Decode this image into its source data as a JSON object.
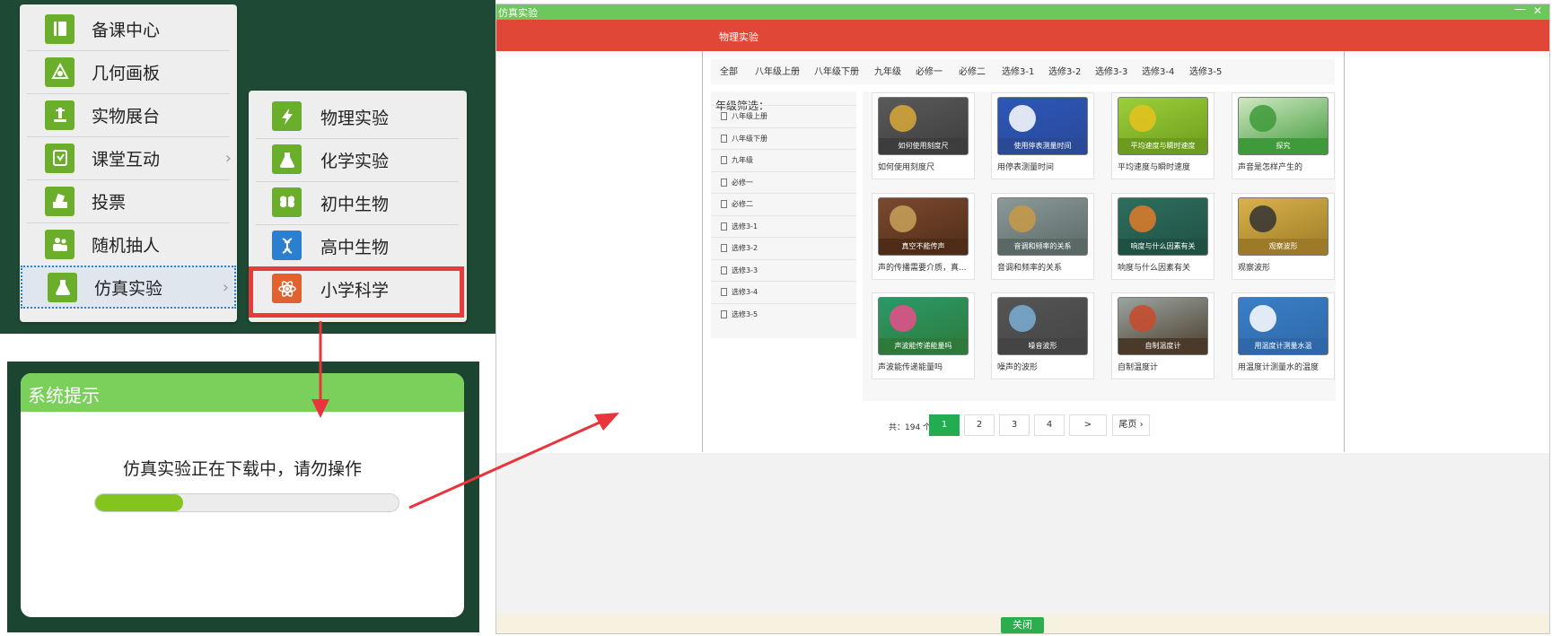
{
  "menu": {
    "items": [
      {
        "label": "备课中心",
        "icon": "book-icon"
      },
      {
        "label": "几何画板",
        "icon": "geometry-icon"
      },
      {
        "label": "实物展台",
        "icon": "projector-icon"
      },
      {
        "label": "课堂互动",
        "icon": "interaction-icon",
        "has_submenu": true
      },
      {
        "label": "投票",
        "icon": "vote-icon"
      },
      {
        "label": "随机抽人",
        "icon": "people-icon"
      },
      {
        "label": "仿真实验",
        "icon": "flask-icon",
        "has_submenu": true,
        "selected": true
      }
    ],
    "arrow": "›"
  },
  "submenu": {
    "items": [
      {
        "label": "物理实验",
        "icon": "lightning-icon",
        "color": "#6aae2c"
      },
      {
        "label": "化学实验",
        "icon": "flask-icon",
        "color": "#6aae2c"
      },
      {
        "label": "初中生物",
        "icon": "butterfly-icon",
        "color": "#6aae2c"
      },
      {
        "label": "高中生物",
        "icon": "dna-icon",
        "color": "#2a7fd0"
      },
      {
        "label": "小学科学",
        "icon": "atom-icon",
        "color": "#e0632f",
        "highlighted": true
      }
    ]
  },
  "dialog": {
    "title": "系统提示",
    "message": "仿真实验正在下载中，请勿操作",
    "progress": 0.29
  },
  "window": {
    "title": "仿真实验",
    "minimize": "—",
    "close": "✕",
    "section": "物理实验",
    "close_button": "关闭",
    "tabs": [
      "全部",
      "八年级上册",
      "八年级下册",
      "九年级",
      "必修一",
      "必修二",
      "选修3-1",
      "选修3-2",
      "选修3-3",
      "选修3-4",
      "选修3-5"
    ],
    "grade_filter_title": "年级筛选：",
    "grade_items": [
      "八年级上册",
      "八年级下册",
      "九年级",
      "必修一",
      "必修二",
      "选修3-1",
      "选修3-2",
      "选修3-3",
      "选修3-4",
      "选修3-5"
    ],
    "cards": [
      {
        "title": "如何使用刻度尺",
        "thumb_text": "如何使用刻度尺",
        "bg": "#5a5a5a",
        "band": "#3d3d3d",
        "accent": "#d9a93a"
      },
      {
        "title": "用停表测量时间",
        "thumb_text": "使用停表测量时间",
        "bg": "#2c56b8",
        "band": "#2a4a98",
        "accent": "#ffffff"
      },
      {
        "title": "平均速度与瞬时速度",
        "thumb_text": "平均速度与瞬时速度",
        "bg": "#9ccf3a",
        "band": "#6b9c1d",
        "accent": "#e8c21f"
      },
      {
        "title": "声音是怎样产生的",
        "thumb_text": "探究",
        "bg": "#cfe7c0",
        "band": "#3e9a3a",
        "accent": "#3e9a3a"
      },
      {
        "title": "声的传播需要介质，真...",
        "thumb_text": "真空不能传声",
        "bg": "#7b4a2e",
        "band": "#4f2c18",
        "accent": "#c8a15a"
      },
      {
        "title": "音调和频率的关系",
        "thumb_text": "音调和频率的关系",
        "bg": "#8b9a98",
        "band": "#5a6866",
        "accent": "#c79a45"
      },
      {
        "title": "响度与什么因素有关",
        "thumb_text": "响度与什么因素有关",
        "bg": "#2f6e5e",
        "band": "#1f5044",
        "accent": "#e07b2a"
      },
      {
        "title": "观察波形",
        "thumb_text": "观察波形",
        "bg": "#d9b24b",
        "band": "#9c7a27",
        "accent": "#333333"
      },
      {
        "title": "声波能传递能量吗",
        "thumb_text": "声波能传递能量吗",
        "bg": "#2a9a68",
        "band": "#2d7a3a",
        "accent": "#e94d8a"
      },
      {
        "title": "噪声的波形",
        "thumb_text": "噪音波形",
        "bg": "#555555",
        "band": "#444444",
        "accent": "#7aaed6"
      },
      {
        "title": "自制温度计",
        "thumb_text": "自制温度计",
        "bg": "#9aa5a0",
        "band": "#4a3a2a",
        "accent": "#c84a2a"
      },
      {
        "title": "用温度计测量水的温度",
        "thumb_text": "用温度计测量水温",
        "bg": "#3a7fc7",
        "band": "#2e68a8",
        "accent": "#ffffff"
      }
    ],
    "pager": {
      "total": "共：194 个",
      "pages": [
        "1",
        "2",
        "3",
        "4"
      ],
      "next": ">",
      "last": "尾页 ›",
      "current": "1"
    }
  },
  "colors": {
    "accent_green": "#7bd05b",
    "red_bar": "#e04737",
    "highlight_red": "#ea3b3b",
    "arrow_red": "#e8343a"
  }
}
